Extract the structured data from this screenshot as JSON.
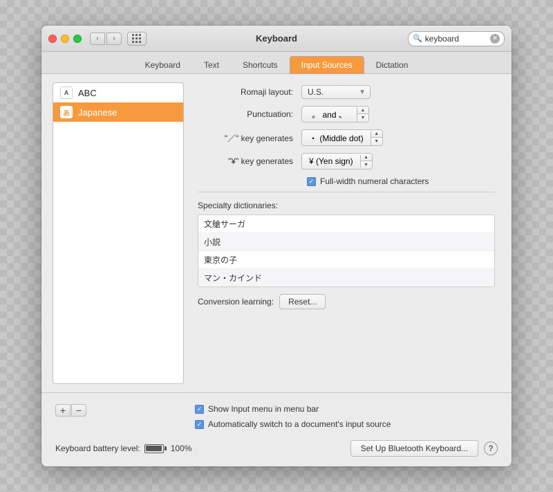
{
  "window": {
    "title": "Keyboard",
    "search_placeholder": "keyboard",
    "search_value": "keyboard"
  },
  "tabs": [
    {
      "id": "keyboard",
      "label": "Keyboard",
      "active": false
    },
    {
      "id": "text",
      "label": "Text",
      "active": false
    },
    {
      "id": "shortcuts",
      "label": "Shortcuts",
      "active": false
    },
    {
      "id": "input_sources",
      "label": "Input Sources",
      "active": true
    },
    {
      "id": "dictation",
      "label": "Dictation",
      "active": false
    }
  ],
  "sources": [
    {
      "id": "abc",
      "label": "ABC",
      "icon": "A"
    },
    {
      "id": "japanese",
      "label": "Japanese",
      "icon": "あ",
      "selected": true
    }
  ],
  "settings": {
    "romaji_layout_label": "Romaji layout:",
    "romaji_layout_value": "U.S.",
    "punctuation_label": "Punctuation:",
    "punctuation_value": "。 and 、",
    "slash_key_label": "\"／\" key generates",
    "slash_key_value": "・ (Middle dot)",
    "yen_key_label": "\"¥\" key generates",
    "yen_key_value": "¥ (Yen sign)",
    "fullwidth_label": "Full-width numeral characters",
    "fullwidth_checked": true,
    "specialty_dicts_label": "Specialty dictionaries:",
    "dictionaries": [
      {
        "id": "dict1",
        "label": "文艙サーガ"
      },
      {
        "id": "dict2",
        "label": "小説"
      },
      {
        "id": "dict3",
        "label": "東京の子"
      },
      {
        "id": "dict4",
        "label": "マン・カインド"
      }
    ],
    "conversion_label": "Conversion learning:",
    "reset_label": "Reset..."
  },
  "bottom": {
    "show_input_menu_label": "Show Input menu in menu bar",
    "show_input_menu_checked": true,
    "auto_switch_label": "Automatically switch to a document's input source",
    "auto_switch_checked": true,
    "add_btn": "+",
    "remove_btn": "−",
    "battery_label": "Keyboard battery level:",
    "battery_value": "100%",
    "bluetooth_btn_label": "Set Up Bluetooth Keyboard...",
    "help_label": "?"
  }
}
